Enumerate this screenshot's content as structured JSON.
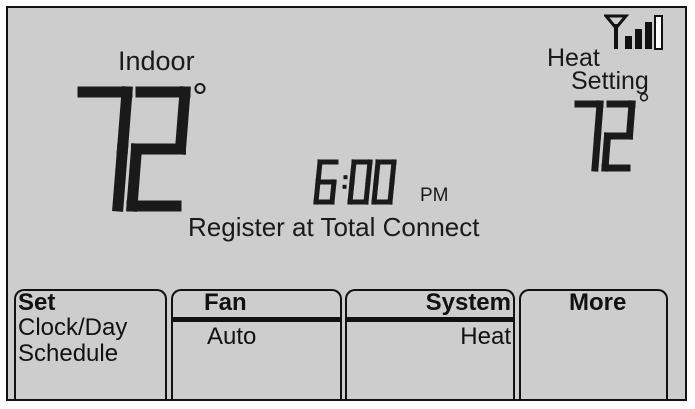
{
  "indoor": {
    "label": "Indoor",
    "temperature": "72",
    "degree_symbol": "°"
  },
  "heat_setting": {
    "label_line1": "Heat",
    "label_line2": "Setting",
    "temperature": "72",
    "degree_symbol": "°"
  },
  "clock": {
    "time": "6:00",
    "ampm": "PM"
  },
  "status_message": "Register at Total Connect",
  "signal_icon": "wifi-signal-icon",
  "buttons": {
    "set": {
      "title": "Set",
      "line1": "Clock/Day",
      "line2": "Schedule"
    },
    "fan": {
      "title": "Fan",
      "value": "Auto"
    },
    "system": {
      "title": "System",
      "value": "Heat"
    },
    "more": {
      "title": "More"
    }
  },
  "colors": {
    "lcd_background": "#cdcdcd",
    "segment": "#1a1a1a"
  }
}
